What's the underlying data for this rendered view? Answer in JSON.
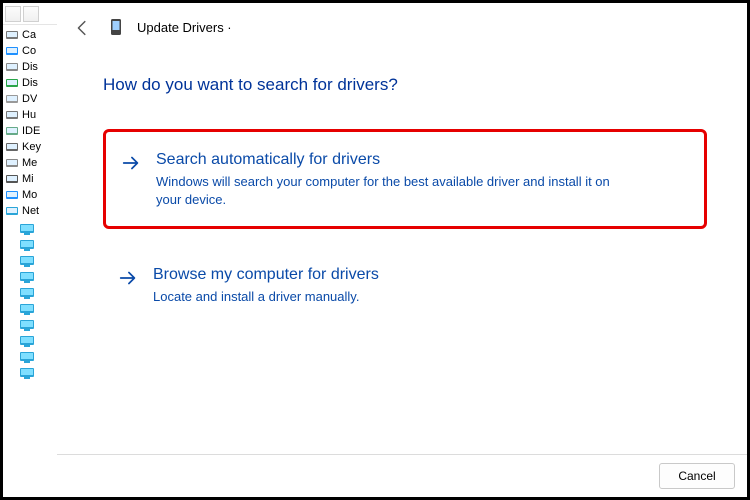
{
  "deviceManager": {
    "items": [
      {
        "label": "Ca",
        "iconColor": "#777"
      },
      {
        "label": "Co",
        "iconColor": "#1e90ff"
      },
      {
        "label": "Dis",
        "iconColor": "#888"
      },
      {
        "label": "Dis",
        "iconColor": "#2aa54a"
      },
      {
        "label": "DV",
        "iconColor": "#999"
      },
      {
        "label": "Hu",
        "iconColor": "#777"
      },
      {
        "label": "IDE",
        "iconColor": "#6a8"
      },
      {
        "label": "Key",
        "iconColor": "#666"
      },
      {
        "label": "Me",
        "iconColor": "#888"
      },
      {
        "label": "Mi",
        "iconColor": "#555"
      },
      {
        "label": "Mo",
        "iconColor": "#1e90ff"
      },
      {
        "label": "Net",
        "iconColor": "#2aa5d8"
      }
    ],
    "adapterCount": 10
  },
  "wizard": {
    "backIcon": "arrow-left",
    "deviceIcon": "device",
    "title": "Update Drivers ·",
    "question": "How do you want to search for drivers?",
    "options": [
      {
        "title": "Search automatically for drivers",
        "description": "Windows will search your computer for the best available driver and install it on your device.",
        "highlighted": true
      },
      {
        "title": "Browse my computer for drivers",
        "description": "Locate and install a driver manually.",
        "highlighted": false
      }
    ],
    "cancelLabel": "Cancel"
  }
}
